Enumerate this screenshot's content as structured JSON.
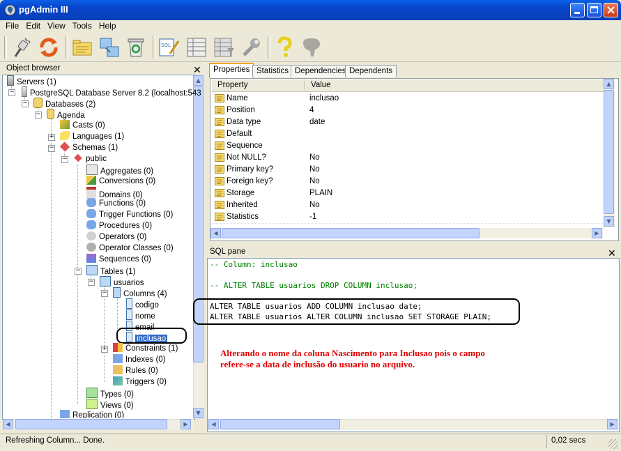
{
  "window": {
    "title": "pgAdmin III"
  },
  "menu": [
    "File",
    "Edit",
    "View",
    "Tools",
    "Help"
  ],
  "object_browser": {
    "title": "Object browser",
    "tree": [
      {
        "label": "Servers (1)",
        "icon": "servers-icon"
      },
      {
        "label": "PostgreSQL Database Server 8.2 (localhost:543",
        "icon": "server-icon"
      },
      {
        "label": "Databases (2)",
        "icon": "databases-icon"
      },
      {
        "label": "Agenda",
        "icon": "database-icon"
      },
      {
        "label": "Casts (0)",
        "icon": "casts-icon"
      },
      {
        "label": "Languages (1)",
        "icon": "languages-icon"
      },
      {
        "label": "Schemas (1)",
        "icon": "schemas-icon"
      },
      {
        "label": "public",
        "icon": "schema-icon"
      },
      {
        "label": "Aggregates (0)",
        "icon": "aggregates-icon"
      },
      {
        "label": "Conversions (0)",
        "icon": "conversions-icon"
      },
      {
        "label": "Domains (0)",
        "icon": "domains-icon"
      },
      {
        "label": "Functions (0)",
        "icon": "functions-icon"
      },
      {
        "label": "Trigger Functions (0)",
        "icon": "trigger-functions-icon"
      },
      {
        "label": "Procedures (0)",
        "icon": "procedures-icon"
      },
      {
        "label": "Operators (0)",
        "icon": "operators-icon"
      },
      {
        "label": "Operator Classes (0)",
        "icon": "operator-classes-icon"
      },
      {
        "label": "Sequences (0)",
        "icon": "sequences-icon"
      },
      {
        "label": "Tables (1)",
        "icon": "tables-icon"
      },
      {
        "label": "usuarios",
        "icon": "table-icon"
      },
      {
        "label": "Columns (4)",
        "icon": "columns-icon"
      },
      {
        "label": "codigo",
        "icon": "column-icon"
      },
      {
        "label": "nome",
        "icon": "column-icon"
      },
      {
        "label": "email",
        "icon": "column-icon"
      },
      {
        "label": "inclusao",
        "icon": "column-icon"
      },
      {
        "label": "Constraints (1)",
        "icon": "constraints-icon"
      },
      {
        "label": "Indexes (0)",
        "icon": "indexes-icon"
      },
      {
        "label": "Rules (0)",
        "icon": "rules-icon"
      },
      {
        "label": "Triggers (0)",
        "icon": "triggers-icon"
      },
      {
        "label": "Types (0)",
        "icon": "types-icon"
      },
      {
        "label": "Views (0)",
        "icon": "views-icon"
      },
      {
        "label": "Replication (0)",
        "icon": "replication-icon"
      }
    ],
    "selected": "inclusao"
  },
  "tabs": [
    "Properties",
    "Statistics",
    "Dependencies",
    "Dependents"
  ],
  "properties": {
    "headers": [
      "Property",
      "Value"
    ],
    "rows": [
      {
        "name": "Name",
        "value": "inclusao"
      },
      {
        "name": "Position",
        "value": "4"
      },
      {
        "name": "Data type",
        "value": "date"
      },
      {
        "name": "Default",
        "value": ""
      },
      {
        "name": "Sequence",
        "value": ""
      },
      {
        "name": "Not NULL?",
        "value": "No"
      },
      {
        "name": "Primary key?",
        "value": "No"
      },
      {
        "name": "Foreign key?",
        "value": "No"
      },
      {
        "name": "Storage",
        "value": "PLAIN"
      },
      {
        "name": "Inherited",
        "value": "No"
      },
      {
        "name": "Statistics",
        "value": "-1"
      }
    ]
  },
  "sql_pane": {
    "title": "SQL pane",
    "lines": [
      "-- Column: inclusao",
      "",
      "-- ALTER TABLE usuarios DROP COLUMN inclusao;",
      "",
      "ALTER TABLE usuarios ADD COLUMN inclusao date;",
      "ALTER TABLE usuarios ALTER COLUMN inclusao SET STORAGE PLAIN;"
    ],
    "annotation": [
      "Alterando o nome da coluna Nascimento para Inclusao pois o campo",
      "refere-se a data de inclusão do usuario no arquivo."
    ]
  },
  "status": {
    "text": "Refreshing Column... Done.",
    "time": "0,02 secs"
  },
  "colors": {
    "comment": "#008000",
    "annotation": "#e00000",
    "selection": "#316ac5",
    "titlebar": "#0845c9"
  }
}
